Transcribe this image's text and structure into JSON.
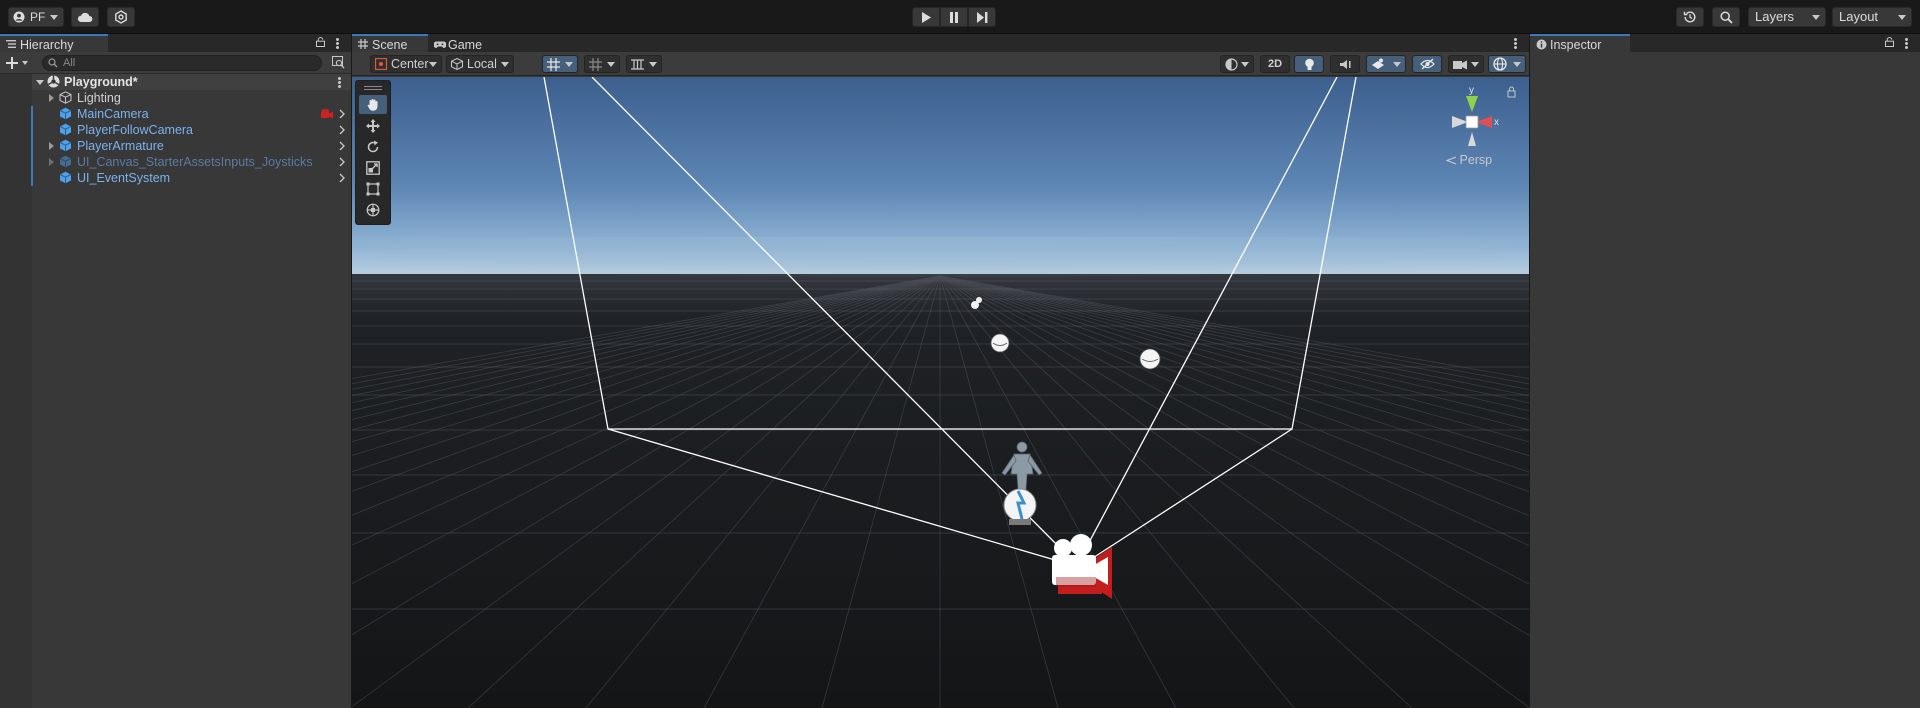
{
  "toolbar": {
    "account_label": "PF",
    "layers_label": "Layers",
    "layout_label": "Layout"
  },
  "hierarchy": {
    "tab_label": "Hierarchy",
    "search_placeholder": "All",
    "scene_name": "Playground*",
    "items": [
      {
        "label": "Lighting"
      },
      {
        "label": "MainCamera"
      },
      {
        "label": "PlayerFollowCamera"
      },
      {
        "label": "PlayerArmature"
      },
      {
        "label": "UI_Canvas_StarterAssetsInputs_Joysticks"
      },
      {
        "label": "UI_EventSystem"
      }
    ]
  },
  "scene": {
    "tab_label": "Scene",
    "game_tab_label": "Game",
    "pivot_label": "Center",
    "space_label": "Local",
    "mode_2d_label": "2D",
    "persp_label": "Persp",
    "gizmo_y_label": "y",
    "gizmo_x_label": "x"
  },
  "inspector": {
    "tab_label": "Inspector"
  },
  "colors": {
    "accent": "#3a79bb",
    "panel": "#383838",
    "toolbar": "#191919",
    "prefab_blue": "#7bb2ee"
  }
}
